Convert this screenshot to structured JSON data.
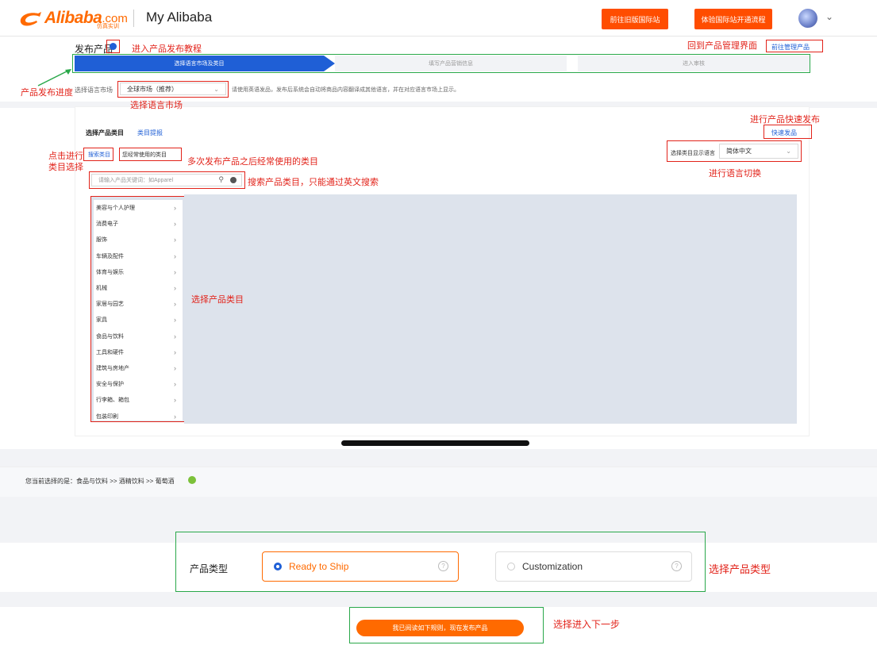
{
  "header": {
    "logo_text": "Alibaba",
    "logo_domain": ".com",
    "logo_sub": "仿真实训",
    "title": "My Alibaba",
    "btn_old_site": "前往旧版国际站",
    "btn_experience": "体验国际站开通流程"
  },
  "page": {
    "title": "发布产品",
    "manage_button": "前往管理产品"
  },
  "steps": [
    "选择语言市场及类目",
    "填写产品营销信息",
    "进入审核"
  ],
  "market": {
    "label": "选择语言市场",
    "value": "全球市场（推荐）",
    "hint": "请使用英语发品，发布后系统会自动将商品内容翻译成其他语言，并在对应语言市场上显示。"
  },
  "category": {
    "title": "选择产品类目",
    "link": "类目提报",
    "quick_publish": "快速发品",
    "tab_search": "搜索类目",
    "tab_frequent": "您经常使用的类目",
    "lang_label": "选择类目显示语言",
    "lang_value": "简体中文",
    "search_placeholder": "请输入产品关键词：如Apparel",
    "items": [
      "美容与个人护理",
      "消费电子",
      "服饰",
      "车辆及配件",
      "体育与娱乐",
      "机械",
      "家居与园艺",
      "家具",
      "食品与饮料",
      "工具和硬件",
      "建筑与房地产",
      "安全与保护",
      "行李箱、箱包",
      "包装印刷"
    ]
  },
  "selection": {
    "label": "您当前选择的是：",
    "path": "食品与饮料 >> 酒精饮料 >> 葡萄酒"
  },
  "product_type": {
    "label": "产品类型",
    "option1": "Ready to Ship",
    "option2": "Customization"
  },
  "publish_button": "我已阅读如下规则，现在发布产品",
  "annotations": {
    "tutorial": "进入产品发布教程",
    "manage": "回到产品管理界面",
    "progress": "产品发布进度",
    "market": "选择语言市场",
    "quick": "进行产品快速发布",
    "click_cat_1": "点击进行",
    "click_cat_2": "类目选择",
    "frequent": "多次发布产品之后经常使用的类目",
    "lang_switch": "进行语言切换",
    "search": "搜索产品类目，只能通过英文搜索",
    "choose_cat": "选择产品类目",
    "choose_type": "选择产品类型",
    "next_step": "选择进入下一步"
  },
  "colors": {
    "accent_blue": "#1f5fd6",
    "brand_orange": "#ff6a00",
    "annotation_red": "#e2231a",
    "annotation_green": "#2aa84a"
  }
}
